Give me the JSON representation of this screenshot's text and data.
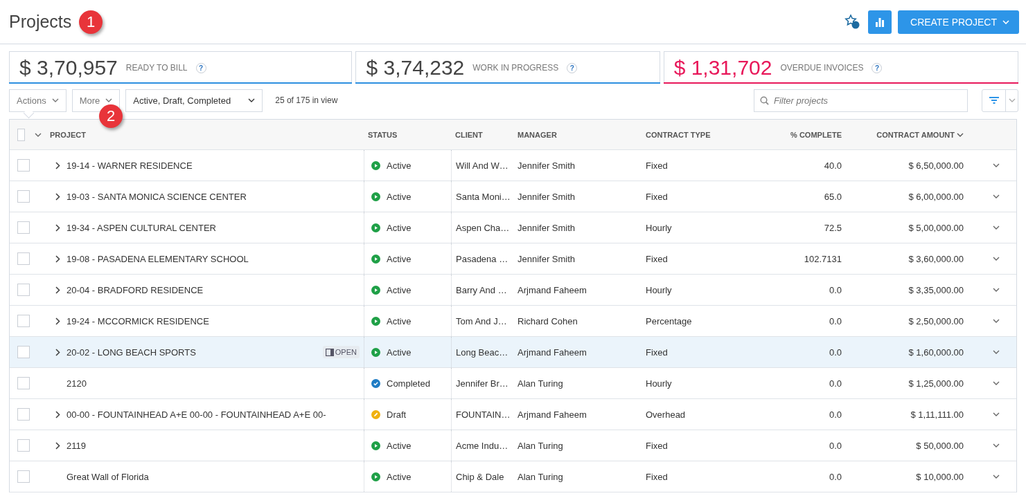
{
  "header": {
    "title": "Projects",
    "create_button": "CREATE PROJECT"
  },
  "callouts": [
    {
      "label": "1"
    },
    {
      "label": "2"
    }
  ],
  "kpis": [
    {
      "amount": "$ 3,70,957",
      "label": "READY TO BILL",
      "color": "#2d8fe0"
    },
    {
      "amount": "$ 3,74,232",
      "label": "WORK IN PROGRESS",
      "color": "#2d8fe0"
    },
    {
      "amount": "$ 1,31,702",
      "label": "OVERDUE INVOICES",
      "color": "#e8185a"
    }
  ],
  "help_mark": "?",
  "toolbar": {
    "actions": "Actions",
    "more": "More",
    "status_filter": "Active, Draft, Completed",
    "count": "25 of 175 in view",
    "search": {
      "placeholder": "Filter projects"
    }
  },
  "table": {
    "select_all_checked": false,
    "columns": [
      {
        "label": "PROJECT",
        "sorted": false
      },
      {
        "label": "STATUS",
        "sorted": false
      },
      {
        "label": "CLIENT",
        "sorted": false
      },
      {
        "label": "MANAGER",
        "sorted": false
      },
      {
        "label": "CONTRACT TYPE",
        "sorted": false
      },
      {
        "label": "% COMPLETE",
        "sorted": false
      },
      {
        "label": "CONTRACT AMOUNT",
        "sorted": true
      }
    ],
    "rows": [
      {
        "checked": false,
        "project": "19-14 - WARNER RESIDENCE",
        "expandable": true,
        "hovered": false,
        "status": "Active",
        "kind": "active",
        "client": "Will And W…",
        "manager": "Jennifer Smith",
        "contract_type": "Fixed",
        "percent": "40.0",
        "amount": "$ 6,50,000.00"
      },
      {
        "checked": false,
        "project": "19-03 - SANTA MONICA SCIENCE CENTER",
        "expandable": true,
        "hovered": false,
        "status": "Active",
        "kind": "active",
        "client": "Santa Moni…",
        "manager": "Jennifer Smith",
        "contract_type": "Fixed",
        "percent": "65.0",
        "amount": "$ 6,00,000.00"
      },
      {
        "checked": false,
        "project": "19-34 - ASPEN CULTURAL CENTER",
        "expandable": true,
        "hovered": false,
        "status": "Active",
        "kind": "active",
        "client": "Aspen Cha…",
        "manager": "Jennifer Smith",
        "contract_type": "Hourly",
        "percent": "72.5",
        "amount": "$ 5,00,000.00"
      },
      {
        "checked": false,
        "project": "19-08 - PASADENA ELEMENTARY SCHOOL",
        "expandable": true,
        "hovered": false,
        "status": "Active",
        "kind": "active",
        "client": "Pasadena …",
        "manager": "Jennifer Smith",
        "contract_type": "Fixed",
        "percent": "102.7131",
        "amount": "$ 3,60,000.00"
      },
      {
        "checked": false,
        "project": "20-04 - BRADFORD RESIDENCE",
        "expandable": true,
        "hovered": false,
        "status": "Active",
        "kind": "active",
        "client": "Barry And …",
        "manager": "Arjmand Faheem",
        "contract_type": "Hourly",
        "percent": "0.0",
        "amount": "$ 3,35,000.00"
      },
      {
        "checked": false,
        "project": "19-24 - MCCORMICK RESIDENCE",
        "expandable": true,
        "hovered": false,
        "status": "Active",
        "kind": "active",
        "client": "Tom And J…",
        "manager": "Richard Cohen",
        "contract_type": "Percentage",
        "percent": "0.0",
        "amount": "$ 2,50,000.00"
      },
      {
        "checked": false,
        "project": "20-02 - LONG BEACH SPORTS",
        "expandable": true,
        "hovered": true,
        "open_label": "OPEN",
        "status": "Active",
        "kind": "active",
        "client": "Long Beac…",
        "manager": "Arjmand Faheem",
        "contract_type": "Fixed",
        "percent": "0.0",
        "amount": "$ 1,60,000.00"
      },
      {
        "checked": false,
        "project": "2120",
        "expandable": false,
        "hovered": false,
        "status": "Completed",
        "kind": "completed",
        "client": "Jennifer Br…",
        "manager": "Alan Turing",
        "contract_type": "Hourly",
        "percent": "0.0",
        "amount": "$ 1,25,000.00"
      },
      {
        "checked": false,
        "project": "00-00 - FOUNTAINHEAD A+E 00-00 - FOUNTAINHEAD A+E 00-",
        "expandable": true,
        "hovered": false,
        "status": "Draft",
        "kind": "draft",
        "client": "FOUNTAIN…",
        "manager": "Arjmand Faheem",
        "contract_type": "Overhead",
        "percent": "0.0",
        "amount": "$ 1,11,111.00"
      },
      {
        "checked": false,
        "project": "2119",
        "expandable": true,
        "hovered": false,
        "status": "Active",
        "kind": "active",
        "client": "Acme Indu…",
        "manager": "Alan Turing",
        "contract_type": "Fixed",
        "percent": "0.0",
        "amount": "$ 50,000.00"
      },
      {
        "checked": false,
        "project": "Great Wall of Florida",
        "expandable": false,
        "hovered": false,
        "status": "Active",
        "kind": "active",
        "client": "Chip & Dale",
        "manager": "Alan Turing",
        "contract_type": "Fixed",
        "percent": "0.0",
        "amount": "$ 10,000.00"
      }
    ]
  }
}
